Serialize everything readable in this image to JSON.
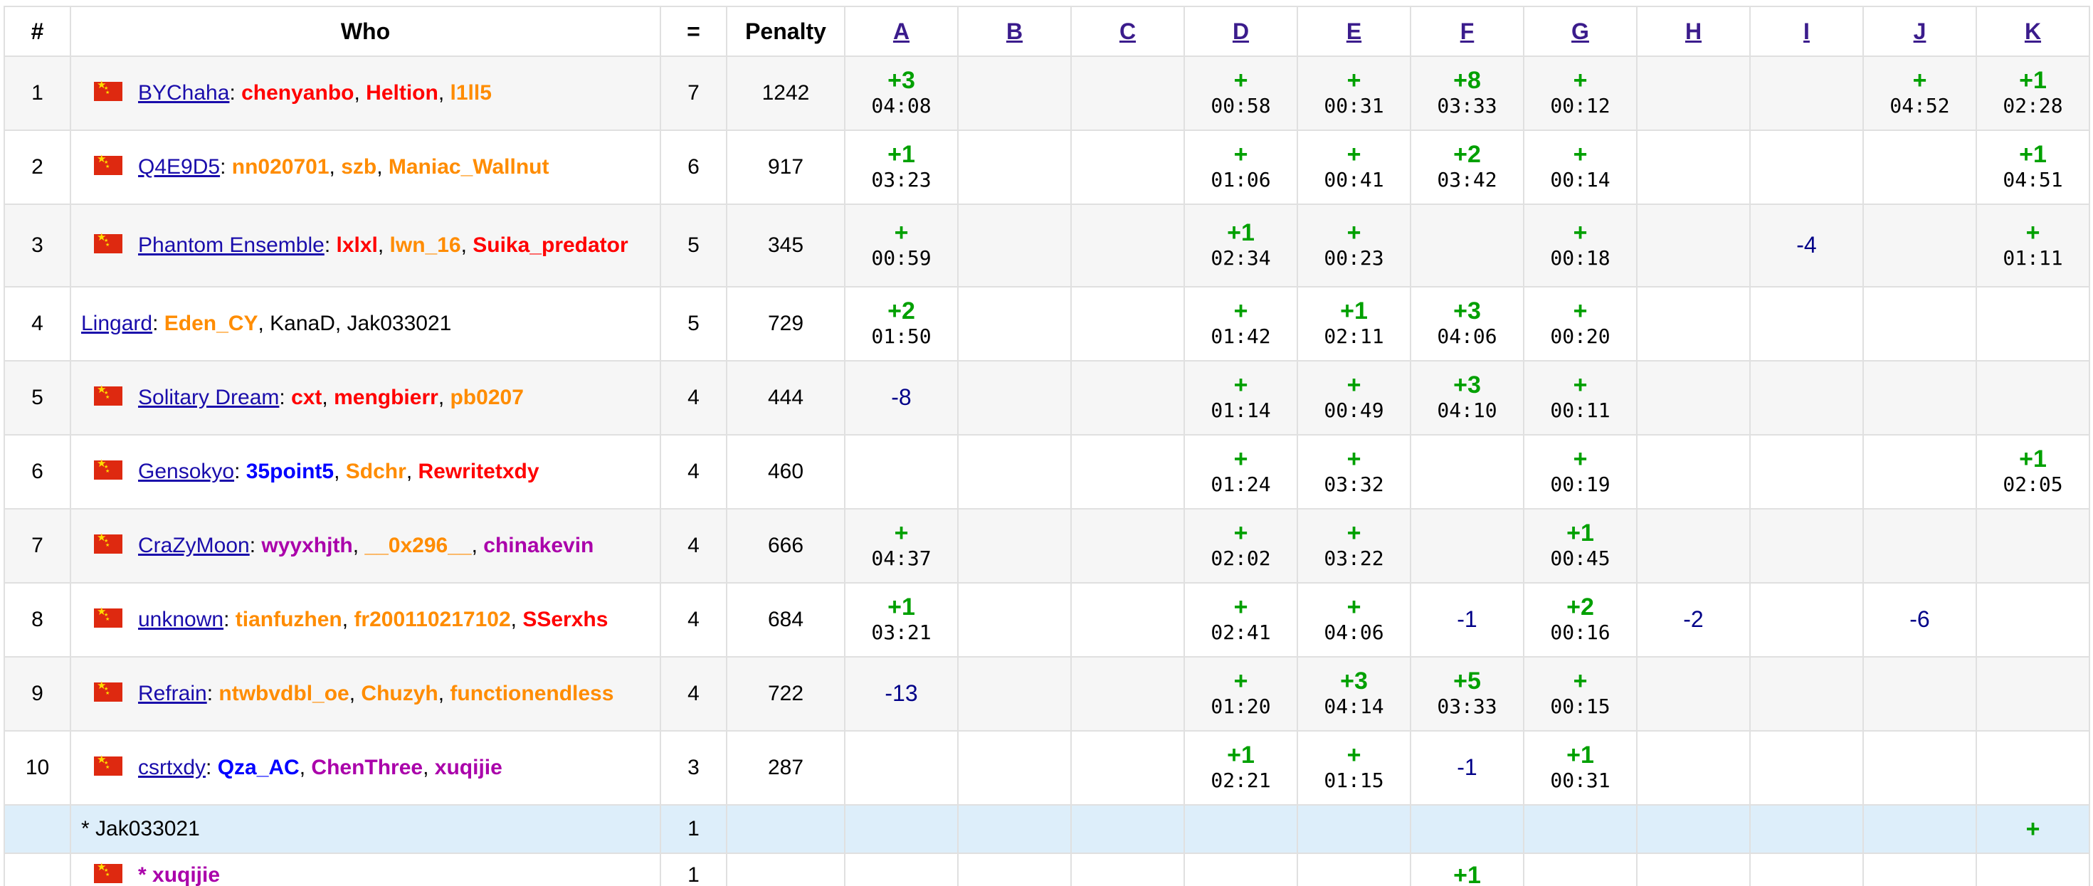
{
  "columns": {
    "rank": "#",
    "who": "Who",
    "solved": "=",
    "penalty": "Penalty",
    "problems": [
      "A",
      "B",
      "C",
      "D",
      "E",
      "F",
      "G",
      "H",
      "I",
      "J",
      "K"
    ]
  },
  "rows": [
    {
      "rank": "1",
      "flag": true,
      "team": "BYChaha",
      "members": [
        {
          "name": "chenyanbo",
          "color": "red"
        },
        {
          "name": "Heltion",
          "color": "red"
        },
        {
          "name": "l1ll5",
          "color": "orange"
        }
      ],
      "solved": "7",
      "penalty": "1242",
      "cells": [
        {
          "r": "+3",
          "t": "04:08"
        },
        null,
        null,
        {
          "r": "+",
          "t": "00:58"
        },
        {
          "r": "+",
          "t": "00:31"
        },
        {
          "r": "+8",
          "t": "03:33"
        },
        {
          "r": "+",
          "t": "00:12"
        },
        null,
        null,
        {
          "r": "+",
          "t": "04:52"
        },
        {
          "r": "+1",
          "t": "02:28"
        }
      ]
    },
    {
      "rank": "2",
      "flag": true,
      "team": "Q4E9D5",
      "members": [
        {
          "name": "nn020701",
          "color": "orange"
        },
        {
          "name": "szb",
          "color": "orange"
        },
        {
          "name": "Maniac_Wallnut",
          "color": "orange"
        }
      ],
      "solved": "6",
      "penalty": "917",
      "cells": [
        {
          "r": "+1",
          "t": "03:23"
        },
        null,
        null,
        {
          "r": "+",
          "t": "01:06"
        },
        {
          "r": "+",
          "t": "00:41"
        },
        {
          "r": "+2",
          "t": "03:42"
        },
        {
          "r": "+",
          "t": "00:14"
        },
        null,
        null,
        null,
        {
          "r": "+1",
          "t": "04:51"
        }
      ]
    },
    {
      "rank": "3",
      "flag": true,
      "team": "Phantom Ensemble",
      "members": [
        {
          "name": "lxlxl",
          "color": "red"
        },
        {
          "name": "lwn_16",
          "color": "orange"
        },
        {
          "name": "Suika_predator",
          "color": "red"
        }
      ],
      "solved": "5",
      "penalty": "345",
      "cells": [
        {
          "r": "+",
          "t": "00:59"
        },
        null,
        null,
        {
          "r": "+1",
          "t": "02:34"
        },
        {
          "r": "+",
          "t": "00:23"
        },
        null,
        {
          "r": "+",
          "t": "00:18"
        },
        null,
        {
          "x": "-4"
        },
        null,
        {
          "r": "+",
          "t": "01:11"
        }
      ]
    },
    {
      "rank": "4",
      "flag": false,
      "team": "Lingard",
      "members": [
        {
          "name": "Eden_CY",
          "color": "orange"
        },
        {
          "name": "KanaD",
          "color": "black"
        },
        {
          "name": "Jak033021",
          "color": "black"
        }
      ],
      "solved": "5",
      "penalty": "729",
      "cells": [
        {
          "r": "+2",
          "t": "01:50"
        },
        null,
        null,
        {
          "r": "+",
          "t": "01:42"
        },
        {
          "r": "+1",
          "t": "02:11"
        },
        {
          "r": "+3",
          "t": "04:06"
        },
        {
          "r": "+",
          "t": "00:20"
        },
        null,
        null,
        null,
        null
      ]
    },
    {
      "rank": "5",
      "flag": true,
      "team": "Solitary Dream",
      "members": [
        {
          "name": "cxt",
          "color": "red"
        },
        {
          "name": "mengbierr",
          "color": "red"
        },
        {
          "name": "pb0207",
          "color": "orange"
        }
      ],
      "solved": "4",
      "penalty": "444",
      "cells": [
        {
          "x": "-8"
        },
        null,
        null,
        {
          "r": "+",
          "t": "01:14"
        },
        {
          "r": "+",
          "t": "00:49"
        },
        {
          "r": "+3",
          "t": "04:10"
        },
        {
          "r": "+",
          "t": "00:11"
        },
        null,
        null,
        null,
        null
      ]
    },
    {
      "rank": "6",
      "flag": true,
      "team": "Gensokyo",
      "members": [
        {
          "name": "35point5",
          "color": "blue"
        },
        {
          "name": "Sdchr",
          "color": "orange"
        },
        {
          "name": "Rewritetxdy",
          "color": "red"
        }
      ],
      "solved": "4",
      "penalty": "460",
      "cells": [
        null,
        null,
        null,
        {
          "r": "+",
          "t": "01:24"
        },
        {
          "r": "+",
          "t": "03:32"
        },
        null,
        {
          "r": "+",
          "t": "00:19"
        },
        null,
        null,
        null,
        {
          "r": "+1",
          "t": "02:05"
        }
      ]
    },
    {
      "rank": "7",
      "flag": true,
      "team": "CraZyMoon",
      "members": [
        {
          "name": "wyyxhjth",
          "color": "violet"
        },
        {
          "name": "__0x296__",
          "color": "orange"
        },
        {
          "name": "chinakevin",
          "color": "violet"
        }
      ],
      "solved": "4",
      "penalty": "666",
      "cells": [
        {
          "r": "+",
          "t": "04:37"
        },
        null,
        null,
        {
          "r": "+",
          "t": "02:02"
        },
        {
          "r": "+",
          "t": "03:22"
        },
        null,
        {
          "r": "+1",
          "t": "00:45"
        },
        null,
        null,
        null,
        null
      ]
    },
    {
      "rank": "8",
      "flag": true,
      "team": "unknown",
      "members": [
        {
          "name": "tianfuzhen",
          "color": "orange"
        },
        {
          "name": "fr200110217102",
          "color": "orange"
        },
        {
          "name": "SSerxhs",
          "color": "red"
        }
      ],
      "solved": "4",
      "penalty": "684",
      "cells": [
        {
          "r": "+1",
          "t": "03:21"
        },
        null,
        null,
        {
          "r": "+",
          "t": "02:41"
        },
        {
          "r": "+",
          "t": "04:06"
        },
        {
          "x": "-1"
        },
        {
          "r": "+2",
          "t": "00:16"
        },
        {
          "x": "-2"
        },
        null,
        {
          "x": "-6"
        },
        null
      ]
    },
    {
      "rank": "9",
      "flag": true,
      "team": "Refrain",
      "members": [
        {
          "name": "ntwbvdbl_oe",
          "color": "orange"
        },
        {
          "name": "Chuzyh",
          "color": "orange"
        },
        {
          "name": "functionendless",
          "color": "orange"
        }
      ],
      "solved": "4",
      "penalty": "722",
      "cells": [
        {
          "x": "-13"
        },
        null,
        null,
        {
          "r": "+",
          "t": "01:20"
        },
        {
          "r": "+3",
          "t": "04:14"
        },
        {
          "r": "+5",
          "t": "03:33"
        },
        {
          "r": "+",
          "t": "00:15"
        },
        null,
        null,
        null,
        null
      ]
    },
    {
      "rank": "10",
      "flag": true,
      "team": "csrtxdy",
      "members": [
        {
          "name": "Qza_AC",
          "color": "blue"
        },
        {
          "name": "ChenThree",
          "color": "violet"
        },
        {
          "name": "xuqijie",
          "color": "violet"
        }
      ],
      "solved": "3",
      "penalty": "287",
      "cells": [
        null,
        null,
        null,
        {
          "r": "+1",
          "t": "02:21"
        },
        {
          "r": "+",
          "t": "01:15"
        },
        {
          "x": "-1"
        },
        {
          "r": "+1",
          "t": "00:31"
        },
        null,
        null,
        null,
        null
      ]
    }
  ],
  "virtual_rows": [
    {
      "label": "* Jak033021",
      "label_color": "black",
      "flag": false,
      "solved": "1",
      "cells": [
        null,
        null,
        null,
        null,
        null,
        null,
        null,
        null,
        null,
        null,
        {
          "r": "+"
        }
      ]
    },
    {
      "label": "* xuqijie",
      "label_color": "violet",
      "flag": true,
      "solved": "1",
      "cells": [
        null,
        null,
        null,
        null,
        null,
        {
          "r": "+1"
        },
        null,
        null,
        null,
        null,
        null
      ]
    }
  ]
}
